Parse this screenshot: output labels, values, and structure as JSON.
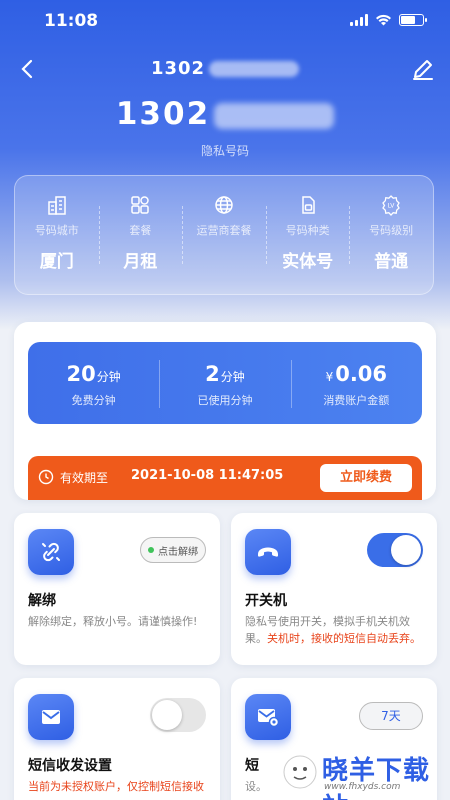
{
  "status_bar": {
    "time": "11:08"
  },
  "nav": {
    "title": "1302"
  },
  "number": {
    "prefix": "130",
    "suffix": "2",
    "caption": "隐私号码"
  },
  "info": [
    {
      "icon": "building-icon",
      "label": "号码城市",
      "value": "厦门"
    },
    {
      "icon": "grid-icon",
      "label": "套餐",
      "value": "月租"
    },
    {
      "icon": "globe-icon",
      "label": "运营商套餐",
      "value": ""
    },
    {
      "icon": "sim-card-icon",
      "label": "号码种类",
      "value": "实体号"
    },
    {
      "icon": "level-badge-icon",
      "label": "号码级别",
      "value": "普通"
    }
  ],
  "usage": {
    "free": {
      "value": "20",
      "unit": "分钟",
      "label": "免费分钟"
    },
    "used": {
      "value": "2",
      "unit": "分钟",
      "label": "已使用分钟"
    },
    "spent": {
      "currency": "¥",
      "value": "0.06",
      "label": "消费账户金额"
    }
  },
  "validity": {
    "label": "有效期至",
    "date": "2021-10-08 11:47:05",
    "renew": "立即续费"
  },
  "features": {
    "unbind": {
      "title": "解绑",
      "desc": "解除绑定，释放小号。请谨慎操作!",
      "button": "点击解绑"
    },
    "power": {
      "title": "开关机",
      "desc": "隐私号使用开关，模拟手机关机效果。",
      "warn": "关机时，接收的短信自动丢弃。",
      "toggle_on": true
    },
    "sms": {
      "title": "短信收发设置",
      "warn": "当前为未授权账户，仅控制短信接收",
      "toggle_on": false
    },
    "sms_forward": {
      "title": "短",
      "desc": "设。",
      "days": "7天"
    }
  },
  "watermark": {
    "text": "晓羊下载站",
    "url": "www.fhxyds.com"
  },
  "colors": {
    "primary": "#2f5fe4",
    "orange": "#ef5a1b",
    "warn": "#e8441b"
  }
}
